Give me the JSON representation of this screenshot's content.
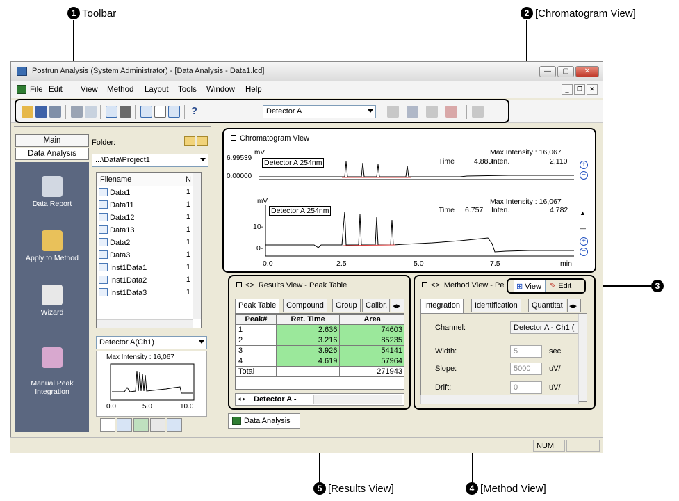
{
  "callouts": {
    "toolbar": {
      "num": "1",
      "label": "Toolbar"
    },
    "chromatogram": {
      "num": "2",
      "label": "[Chromatogram View]"
    },
    "view_edit": {
      "num": "3"
    },
    "method": {
      "num": "4",
      "label": "[Method View]"
    },
    "results": {
      "num": "5",
      "label": "[Results View]"
    }
  },
  "window": {
    "title": "Postrun Analysis (System Administrator) - [Data Analysis - Data1.lcd]"
  },
  "menu": [
    "File",
    "Edit",
    "View",
    "Method",
    "Layout",
    "Tools",
    "Window",
    "Help"
  ],
  "toolbar": {
    "detector_select": "Detector A",
    "help_label": "?"
  },
  "assistant": {
    "tab_main": "Main",
    "tab_data_analysis": "Data Analysis",
    "items": [
      "Data Report",
      "Apply to Method",
      "Wizard",
      "Manual Peak\nIntegration"
    ]
  },
  "file_panel": {
    "folder_label": "Folder:",
    "folder_path": "...\\Data\\Project1",
    "col_filename": "Filename",
    "col_n": "N",
    "files": [
      {
        "name": "Data1",
        "n": "1"
      },
      {
        "name": "Data11",
        "n": "1"
      },
      {
        "name": "Data12",
        "n": "1"
      },
      {
        "name": "Data13",
        "n": "1"
      },
      {
        "name": "Data2",
        "n": "1"
      },
      {
        "name": "Data3",
        "n": "1"
      },
      {
        "name": "Inst1Data1",
        "n": "1"
      },
      {
        "name": "Inst1Data2",
        "n": "1"
      },
      {
        "name": "Inst1Data3",
        "n": "1"
      }
    ],
    "detector_combo": "Detector A(Ch1)",
    "mini_max_intensity": "Max Intensity : 16,067",
    "mini_ticks": [
      "0.0",
      "5.0",
      "10.0"
    ]
  },
  "chromatogram_view": {
    "title": "Chromatogram View",
    "top": {
      "unit": "mV",
      "y_max": "6.99539",
      "y_min": "0.00000",
      "label": "Detector A 254nm",
      "max_intensity": "Max Intensity : 16,067",
      "time_label": "Time",
      "time_value": "4.883",
      "inten_label": "Inten.",
      "inten_value": "2,110"
    },
    "bottom": {
      "unit": "mV",
      "label": "Detector A 254nm",
      "max_intensity": "Max Intensity : 16,067",
      "time_label": "Time",
      "time_value": "6.757",
      "inten_label": "Inten.",
      "inten_value": "4,782",
      "y_ticks": [
        "10-",
        "0-"
      ],
      "x_ticks": [
        "0.0",
        "2.5",
        "5.0",
        "7.5"
      ],
      "x_unit": "min"
    }
  },
  "results_view": {
    "title": "Results View - Peak Table",
    "tabs": [
      "Peak Table",
      "Compound",
      "Group",
      "Calibr."
    ],
    "headers": [
      "Peak#",
      "Ret. Time",
      "Area"
    ],
    "rows": [
      {
        "peak": "1",
        "rt": "2.636",
        "area": "74603"
      },
      {
        "peak": "2",
        "rt": "3.216",
        "area": "85235"
      },
      {
        "peak": "3",
        "rt": "3.926",
        "area": "54141"
      },
      {
        "peak": "4",
        "rt": "4.619",
        "area": "57964"
      }
    ],
    "total_label": "Total",
    "total_area": "271943",
    "bottom_tab": "Detector A -"
  },
  "method_view": {
    "title": "Method View - Pe",
    "view_btn": "View",
    "edit_btn": "Edit",
    "tabs": [
      "Integration",
      "Identification",
      "Quantitat"
    ],
    "channel_label": "Channel:",
    "channel_value": "Detector A - Ch1 (",
    "width_label": "Width:",
    "width_value": "5",
    "width_unit": "sec",
    "slope_label": "Slope:",
    "slope_value": "5000",
    "slope_unit": "uV/",
    "drift_label": "Drift:",
    "drift_value": "0",
    "drift_unit": "uV/"
  },
  "bottom_tab": "Data Analysis",
  "status": {
    "num": "NUM"
  }
}
